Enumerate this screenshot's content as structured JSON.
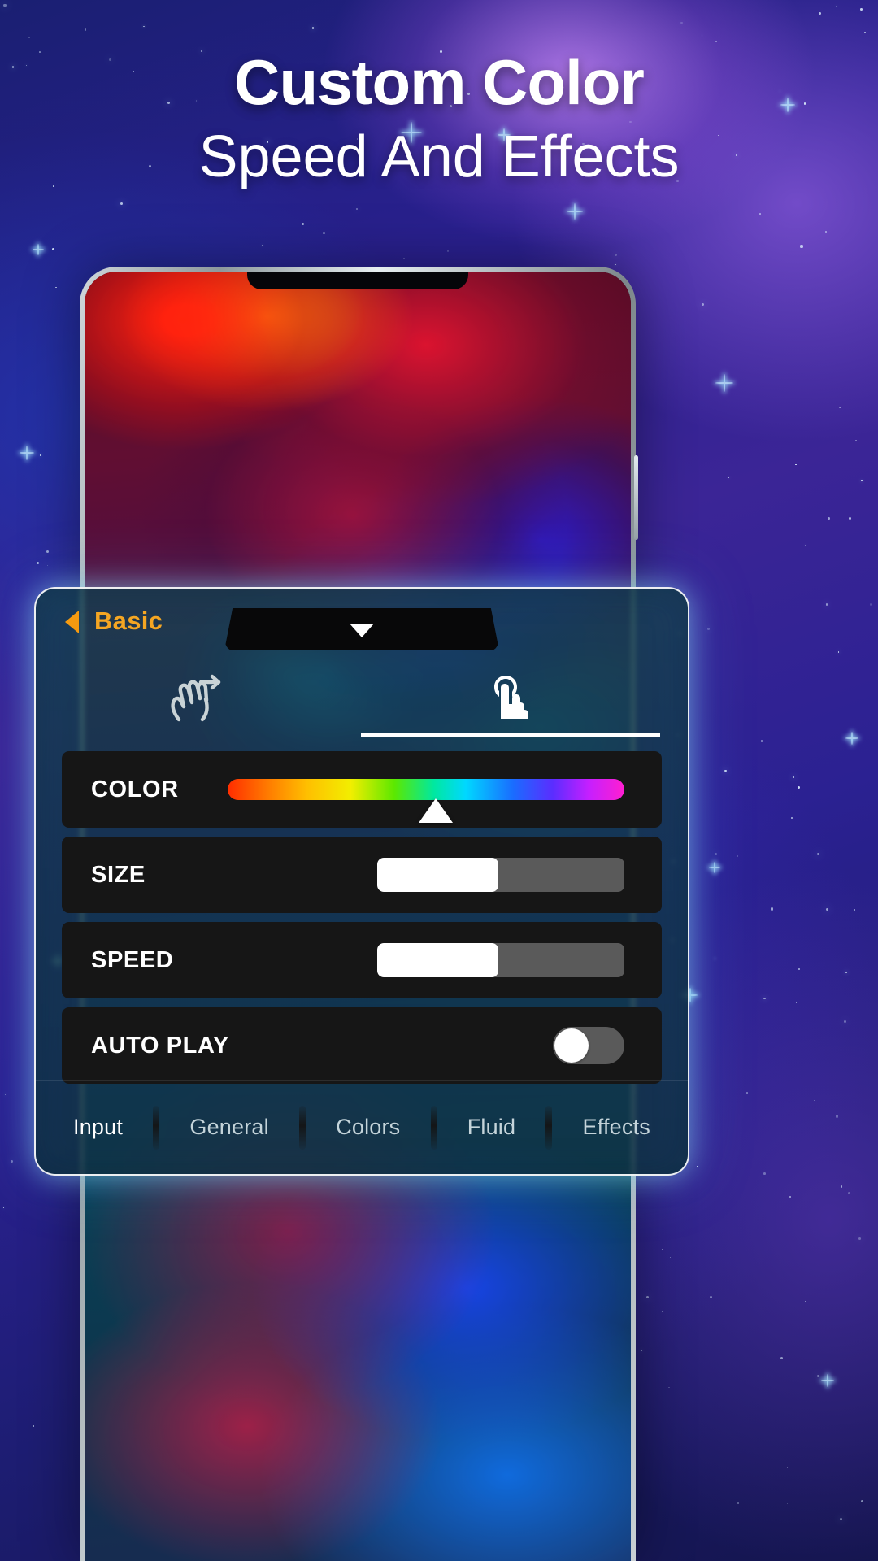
{
  "headline": {
    "main": "Custom Color",
    "sub": "Speed And Effects"
  },
  "panel": {
    "back_icon": "back-triangle-icon",
    "title": "Basic",
    "dropdown": {
      "caret_icon": "chevron-down-icon",
      "value": ""
    },
    "gesture_tabs": [
      {
        "name": "swipe-gesture-icon",
        "label": "Swipe",
        "active": false
      },
      {
        "name": "tap-gesture-icon",
        "label": "Tap",
        "active": true
      }
    ],
    "rows": [
      {
        "label": "COLOR",
        "control": "gradient-slider",
        "value_percent": 46,
        "gradient_stops": [
          "#ff2d00",
          "#ff7a00",
          "#ffbf00",
          "#f2ee00",
          "#5ce800",
          "#00e8a0",
          "#00d8ff",
          "#1a6cff",
          "#5b2dff",
          "#c51fff",
          "#ff1fd0"
        ]
      },
      {
        "label": "SIZE",
        "control": "slider",
        "value_percent": 49
      },
      {
        "label": "SPEED",
        "control": "slider",
        "value_percent": 49
      },
      {
        "label": "AUTO PLAY",
        "control": "toggle",
        "value": "off"
      }
    ],
    "tabs": [
      {
        "label": "Input",
        "active": true
      },
      {
        "label": "General",
        "active": false
      },
      {
        "label": "Colors",
        "active": false
      },
      {
        "label": "Fluid",
        "active": false
      },
      {
        "label": "Effects",
        "active": false
      }
    ]
  },
  "colors": {
    "accent_orange": "#f5a623",
    "row_background": "#161616",
    "slider_track": "#5a5a5a",
    "slider_fill": "#ffffff",
    "panel_border": "#ffffff",
    "text_white": "#ffffff"
  }
}
